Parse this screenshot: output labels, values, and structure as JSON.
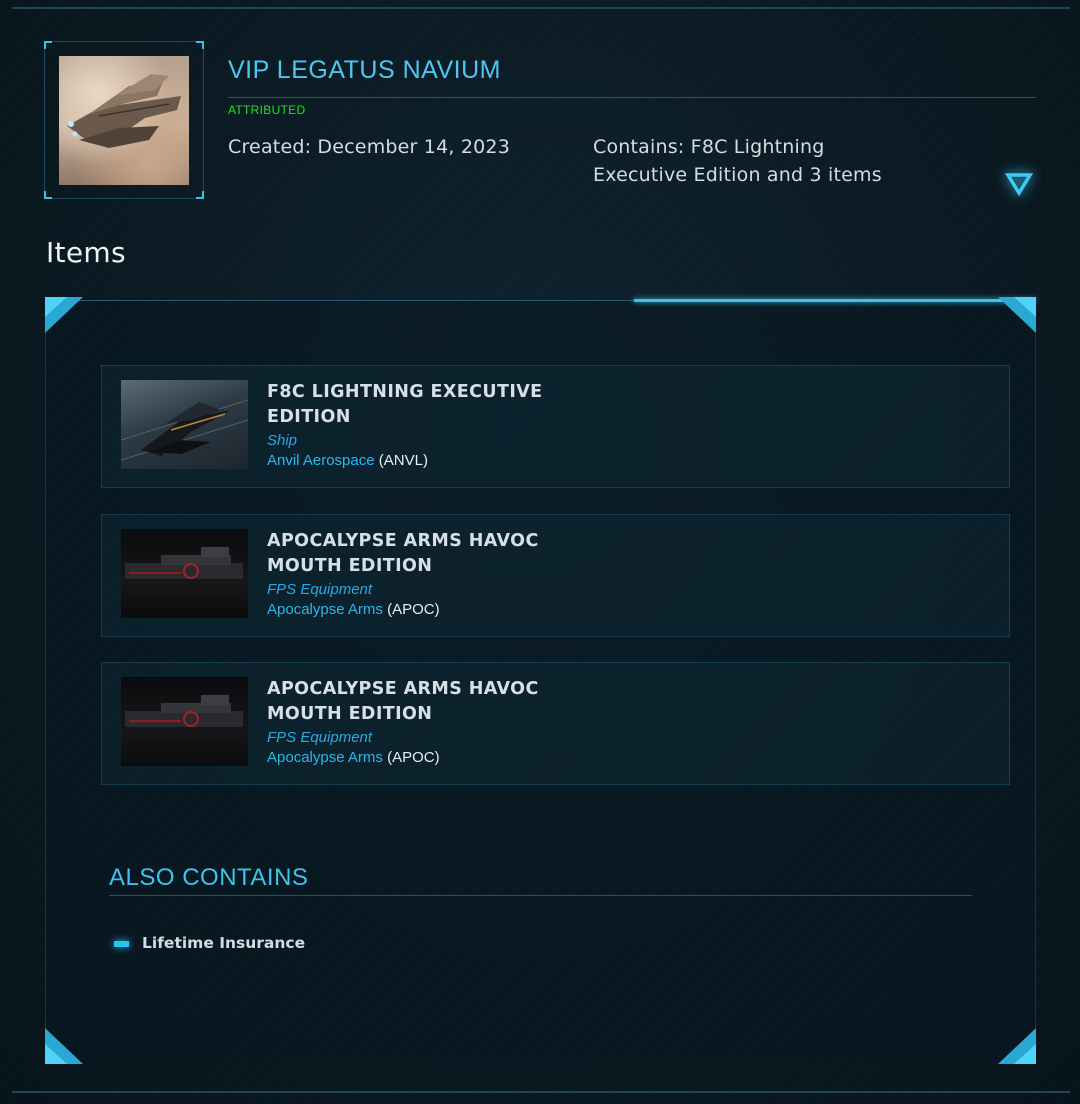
{
  "pledge": {
    "title": "VIP LEGATUS NAVIUM",
    "status": "ATTRIBUTED",
    "created": "Created: December 14, 2023",
    "contains": "Contains: F8C Lightning Executive Edition and 3 items",
    "toggle_icon": "chevron-down-triangle-icon"
  },
  "items_section": {
    "heading": "Items",
    "items": [
      {
        "name": "F8C LIGHTNING EXECUTIVE EDITION",
        "kind": "Ship",
        "maker": "Anvil Aerospace",
        "maker_code": "ANVL",
        "image": "ship-thumbnail"
      },
      {
        "name": "APOCALYPSE ARMS HAVOC MOUTH EDITION",
        "kind": "FPS Equipment",
        "maker": "Apocalypse Arms",
        "maker_code": "APOC",
        "image": "weapon-thumbnail"
      },
      {
        "name": "APOCALYPSE ARMS HAVOC MOUTH EDITION",
        "kind": "FPS Equipment",
        "maker": "Apocalypse Arms",
        "maker_code": "APOC",
        "image": "weapon-thumbnail"
      }
    ]
  },
  "also_contains": {
    "heading": "ALSO CONTAINS",
    "items": [
      "Lifetime Insurance"
    ]
  },
  "colors": {
    "accent": "#3ec2ee",
    "status": "#23e01f",
    "background": "#0a1a22"
  }
}
